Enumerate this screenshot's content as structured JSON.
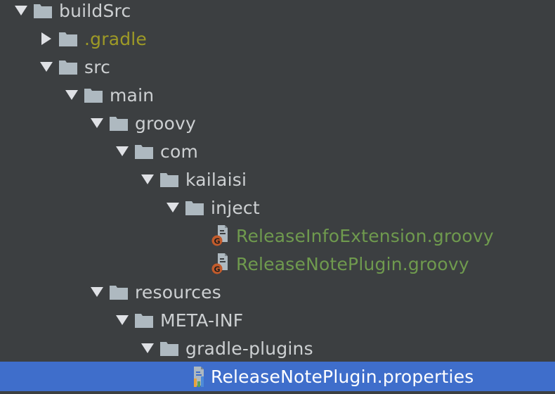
{
  "tree": {
    "items": [
      {
        "label": "buildSrc",
        "depth": 0,
        "expanded": true,
        "kind": "folder",
        "style": "normal"
      },
      {
        "label": ".gradle",
        "depth": 1,
        "expanded": false,
        "kind": "folder",
        "style": "gradle"
      },
      {
        "label": "src",
        "depth": 1,
        "expanded": true,
        "kind": "folder",
        "style": "normal"
      },
      {
        "label": "main",
        "depth": 2,
        "expanded": true,
        "kind": "folder",
        "style": "normal"
      },
      {
        "label": "groovy",
        "depth": 3,
        "expanded": true,
        "kind": "folder",
        "style": "normal"
      },
      {
        "label": "com",
        "depth": 4,
        "expanded": true,
        "kind": "folder",
        "style": "normal"
      },
      {
        "label": "kailaisi",
        "depth": 5,
        "expanded": true,
        "kind": "folder",
        "style": "normal"
      },
      {
        "label": "inject",
        "depth": 6,
        "expanded": true,
        "kind": "folder",
        "style": "normal"
      },
      {
        "label": "ReleaseInfoExtension.groovy",
        "depth": 7,
        "kind": "groovy-file",
        "style": "groovy"
      },
      {
        "label": "ReleaseNotePlugin.groovy",
        "depth": 7,
        "kind": "groovy-file",
        "style": "groovy"
      },
      {
        "label": "resources",
        "depth": 3,
        "expanded": true,
        "kind": "folder",
        "style": "normal"
      },
      {
        "label": "META-INF",
        "depth": 4,
        "expanded": true,
        "kind": "folder",
        "style": "normal"
      },
      {
        "label": "gradle-plugins",
        "depth": 5,
        "expanded": true,
        "kind": "folder",
        "style": "normal"
      },
      {
        "label": "ReleaseNotePlugin.properties",
        "depth": 6,
        "kind": "properties-file",
        "style": "normal",
        "selected": true
      }
    ]
  },
  "colors": {
    "background": "#3c3f41",
    "selection": "#3f6ecb",
    "folder_icon": "#aeb9c0",
    "arrow": "#dfe1e5",
    "gradle_text": "#9e9a26",
    "groovy_text": "#6f9a4e",
    "groovy_badge": "#c25b2b"
  },
  "icons": {
    "folder": "folder-icon",
    "groovy_file": "groovy-file-icon",
    "properties_file": "properties-file-icon",
    "expanded": "chevron-down-icon",
    "collapsed": "chevron-right-icon"
  }
}
